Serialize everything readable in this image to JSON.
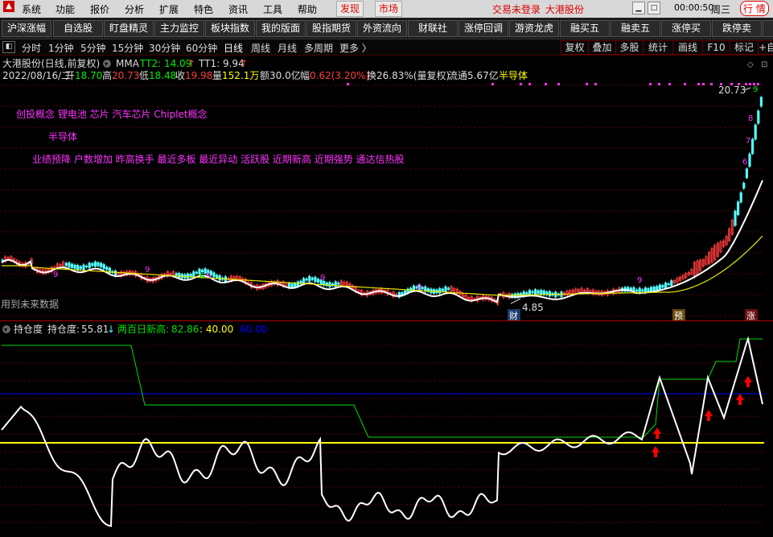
{
  "menu": {
    "items": [
      "系统",
      "功能",
      "报价",
      "分析",
      "扩展",
      "特色",
      "资讯",
      "工具",
      "帮助"
    ],
    "discover": "发现",
    "market": "市场",
    "login_status": "交易未登录",
    "stock_title": "大港股份",
    "time": "00:00:50",
    "weekday": "周三",
    "right_tab": "行",
    "right_tab2": "情"
  },
  "toolbar": {
    "buttons": [
      "沪深涨幅",
      "自选股",
      "盯盘精灵",
      "主力监控",
      "板块指数",
      "我的版面",
      "股指期货",
      "外资流向",
      "财联社",
      "涨停回调",
      "游资龙虎",
      "融买五",
      "融卖五",
      "涨停买",
      "跌停卖"
    ]
  },
  "period": {
    "items": [
      "分时",
      "1分钟",
      "5分钟",
      "15分钟",
      "30分钟",
      "60分钟",
      "日线",
      "周线",
      "月线",
      "多周期",
      "更多 〉"
    ],
    "active": "日线",
    "right": [
      "复权",
      "叠加",
      "多股",
      "统计",
      "画线",
      "F10",
      "标记",
      "+自"
    ]
  },
  "chart": {
    "title": "大港股份(日线,前复权)",
    "indicator": "MMA",
    "tt2": "TT2: 14.09",
    "tt1": "TT1: 9.94",
    "date": "2022/08/16/二",
    "open_label": "开",
    "open": "18.70",
    "high_label": "高",
    "high": "20.73",
    "low_label": "低",
    "low": "18.48",
    "close_label": "收",
    "close": "19.98",
    "vol_label": "量",
    "vol": "152.1万",
    "amt_label": "额",
    "amt": "30.0亿",
    "chg_label": "幅",
    "chg": "0.62(3.20%)",
    "turn_label": "换",
    "turn": "26.83%(量复权)",
    "float_label": "流通",
    "float": "5.67亿",
    "sector": "半导体",
    "concepts": "创投概念 锂电池 芯片 汽车芯片 Chiplet概念",
    "sector2": "半导体",
    "tags": "业绩预降 户数增加 昨高换手 最近多板 最近异动 活跃股 近期新高 近期强势 通达信热股",
    "high_mark": "20.73",
    "low_mark": "4.85",
    "future_note": "用到未来数据",
    "marker_cai": "财",
    "marker_yu": "预",
    "marker_zhang": "涨"
  },
  "sub": {
    "name": "持仓度",
    "label": "持仓度:",
    "value": "55.81",
    "high_label": "两百日新高:",
    "high_value": "82.86",
    "level40": ": 40.00",
    "level60": "60.00"
  },
  "colors": {
    "up": "#ff3c3c",
    "down": "#54fcfc",
    "ma_white": "#ffffff",
    "ma_yellow": "#e8e800",
    "sub_green": "#00dd00",
    "sub_blue": "#0000ff",
    "sub_yellow": "#ffff00",
    "magenta": "#ff33ff"
  }
}
